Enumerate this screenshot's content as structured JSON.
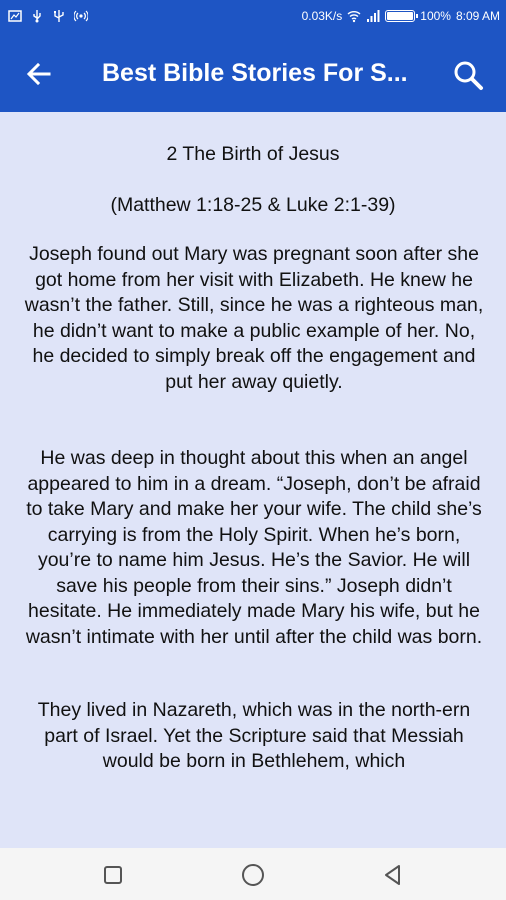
{
  "status_bar": {
    "speed": "0.03K/s",
    "battery": "100%",
    "time": "8:09 AM"
  },
  "app_bar": {
    "title": "Best Bible Stories For S...",
    "back_icon": "arrow-left-icon",
    "search_icon": "search-icon",
    "color": "#1e55c4"
  },
  "story": {
    "title": "2 The Birth of Jesus",
    "reference": "(Matthew 1:18-25 & Luke 2:1-39)",
    "paragraphs": [
      "Joseph found out Mary was pregnant soon after she got home from her visit with Elizabeth. He knew he wasn’t the father. Still, since he was a righteous man, he didn’t want to make a public example of her. No, he decided to simply break off the engagement and put her away quietly.",
      "He was deep in thought about this when an angel appeared to him in a dream. “Joseph, don’t be afraid to take Mary and make her your wife. The child she’s carrying is from the Holy Spirit. When he’s born, you’re to name him Jesus. He’s the Savior. He will save his people from their sins.” Joseph didn’t hesitate. He immediately made Mary his wife, but he wasn’t intimate with her until after the child was born.",
      "They lived in Nazareth, which was in the north-ern part of Israel. Yet the Scripture said that Messiah would be born in Bethlehem, which"
    ]
  },
  "nav": {
    "recents_icon": "square-icon",
    "home_icon": "circle-icon",
    "back_icon": "triangle-back-icon"
  },
  "colors": {
    "background": "#dfe4f8",
    "text": "#111111"
  }
}
